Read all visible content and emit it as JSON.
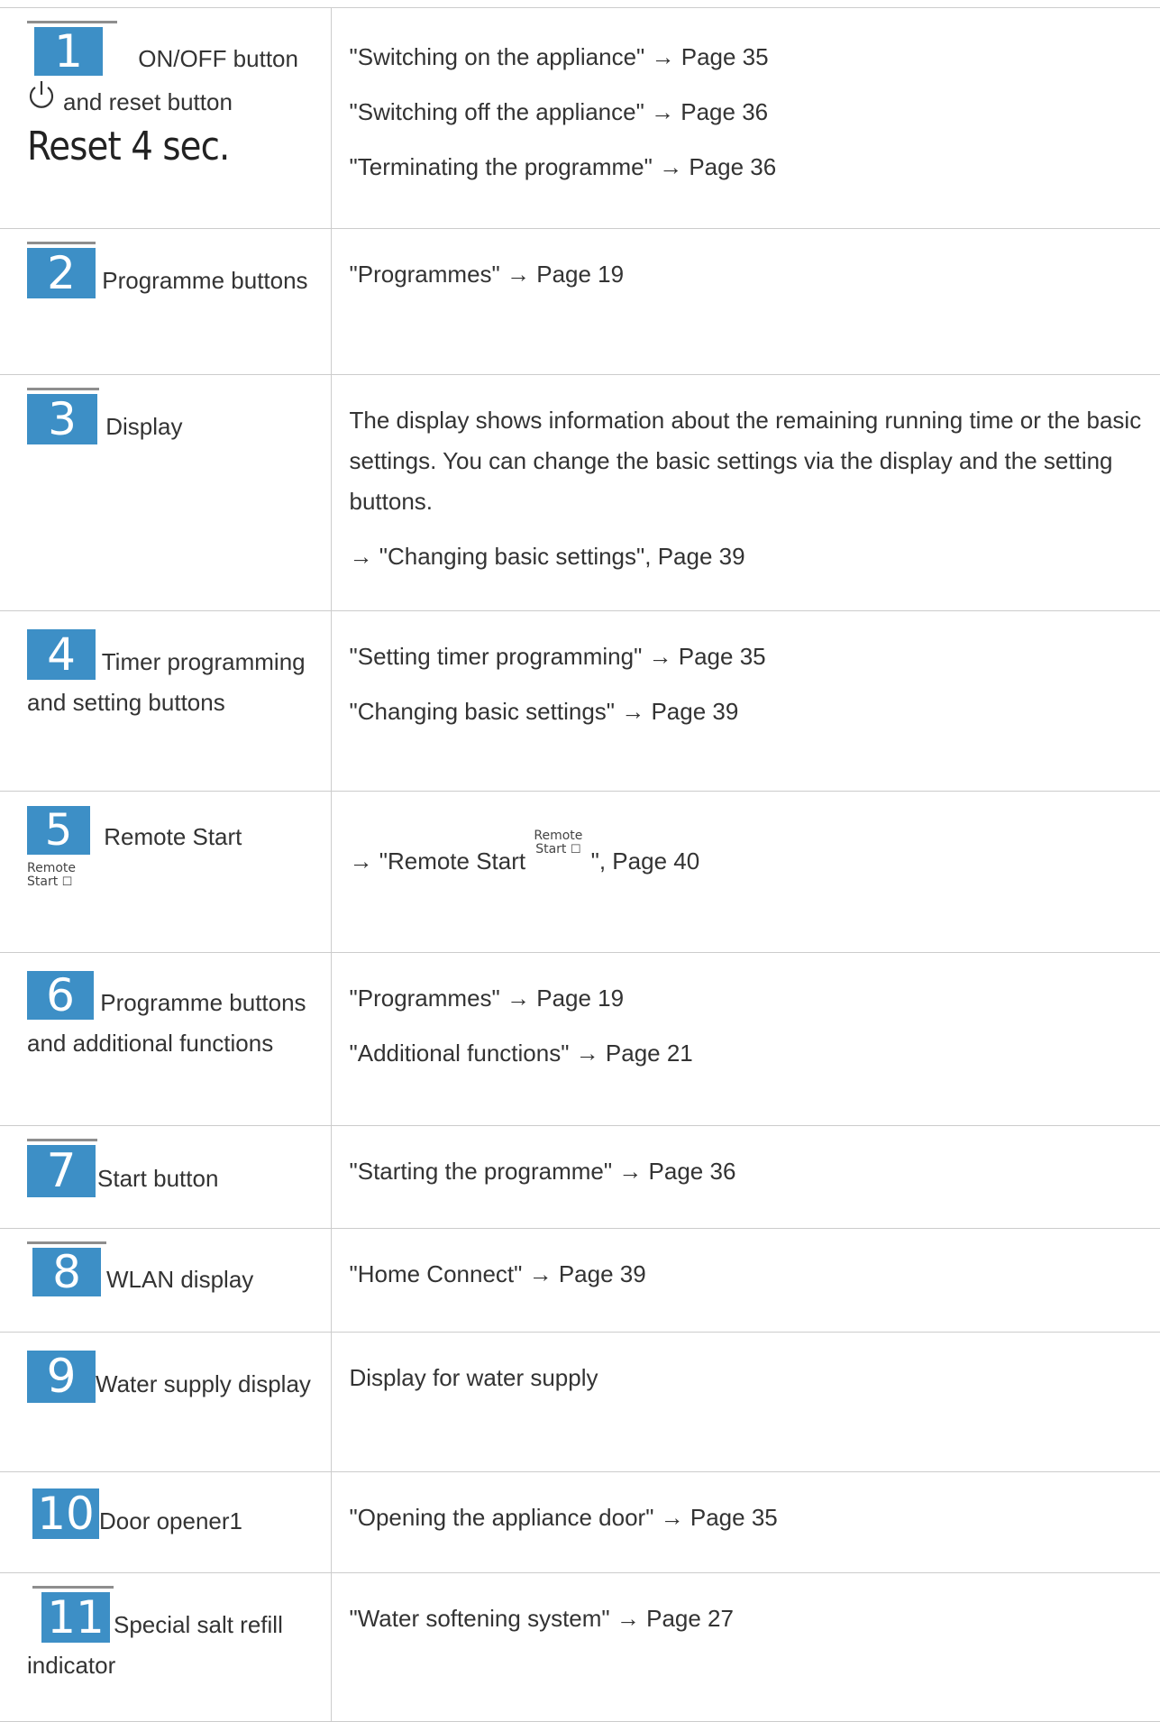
{
  "rows": [
    {
      "number": "1",
      "label_a": "ON/OFF button",
      "label_b": "and reset button",
      "reset_text": "Reset 4 sec.",
      "icon": "power-icon",
      "refs": [
        "\"Switching on the appliance\" → Page 35",
        "\"Switching off the appliance\" → Page 36",
        "\"Terminating the programme\" → Page 36"
      ]
    },
    {
      "number": "2",
      "label": "Programme buttons",
      "refs": [
        "\"Programmes\" → Page 19"
      ]
    },
    {
      "number": "3",
      "label": "Display",
      "description": "The display shows information about the remaining running time or the basic settings. You can change the basic settings via the display and the setting buttons.",
      "refs": [
        "→ \"Changing basic settings\", Page 39"
      ]
    },
    {
      "number": "4",
      "label": "Timer programming and setting buttons",
      "refs": [
        "\"Setting timer programming\" → Page 35",
        "\"Changing basic settings\" → Page 39"
      ]
    },
    {
      "number": "5",
      "label": "Remote Start",
      "icon_line1": "Remote",
      "icon_line2": "Start",
      "ref_prefix": "→ \"Remote Start",
      "ref_suffix": "\", Page 40"
    },
    {
      "number": "6",
      "label": "Programme buttons and additional functions",
      "refs": [
        "\"Programmes\" → Page 19",
        "\"Additional functions\" → Page 21"
      ]
    },
    {
      "number": "7",
      "label": "Start button",
      "refs": [
        "\"Starting the programme\" → Page 36"
      ]
    },
    {
      "number": "8",
      "label": "WLAN display",
      "refs": [
        "\"Home Connect\" → Page 39"
      ]
    },
    {
      "number": "9",
      "label": "Water supply display",
      "refs": [
        "Display for water supply"
      ]
    },
    {
      "number": "10",
      "label": "Door opener1",
      "refs": [
        "\"Opening the appliance door\" → Page 35"
      ]
    },
    {
      "number": "11",
      "label": "Special salt refill indicator",
      "refs": [
        "\"Water softening system\" → Page 27"
      ]
    }
  ],
  "colors": {
    "badge": "#3d8fc6",
    "border": "#cccccc",
    "text": "#333333"
  }
}
